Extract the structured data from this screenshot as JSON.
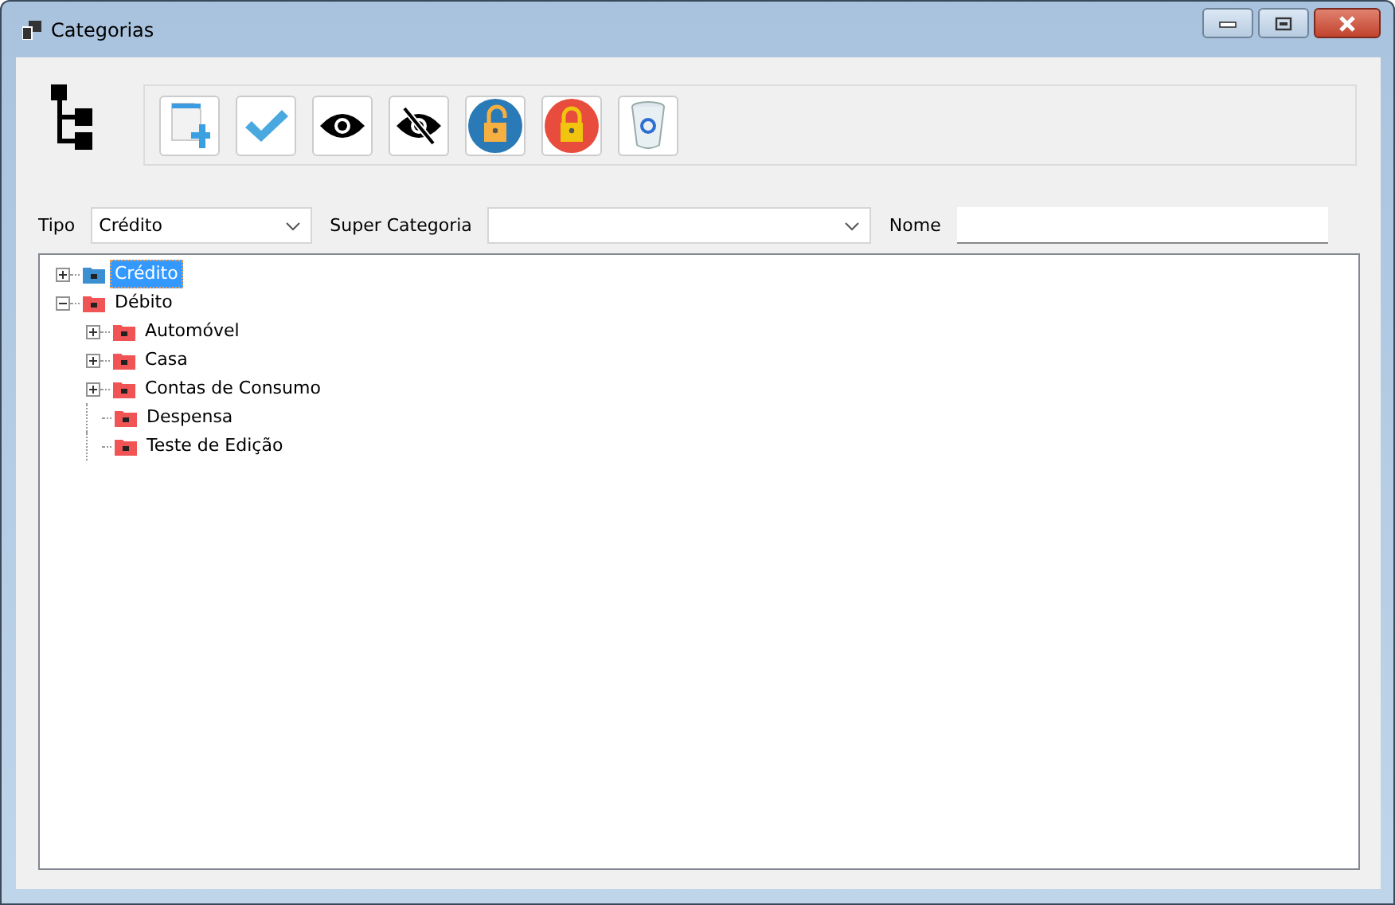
{
  "window": {
    "title": "Categorias"
  },
  "toolbar": {
    "buttons": [
      {
        "kind": "new"
      },
      {
        "kind": "confirm"
      },
      {
        "kind": "show"
      },
      {
        "kind": "hide"
      },
      {
        "kind": "unlock"
      },
      {
        "kind": "lock"
      },
      {
        "kind": "delete"
      }
    ]
  },
  "filters": {
    "tipo_label": "Tipo",
    "tipo_value": "Crédito",
    "super_label": "Super Categoria",
    "nome_label": "Nome"
  },
  "tree": [
    {
      "label": "Crédito",
      "color": "#3c8fd0",
      "expanded": false,
      "selected": true
    },
    {
      "label": "Débito",
      "color": "#f05454",
      "expanded": true,
      "selected": false,
      "children": [
        {
          "label": "Automóvel",
          "color": "#f05454",
          "expanded": false,
          "selected": false
        },
        {
          "label": "Casa",
          "color": "#f05454",
          "expanded": false,
          "selected": false
        },
        {
          "label": "Contas de Consumo",
          "color": "#f05454",
          "expanded": false,
          "selected": false
        },
        {
          "label": "Despensa",
          "color": "#f05454",
          "selected": false
        },
        {
          "label": "Teste de Edição",
          "color": "#f05454",
          "selected": false
        }
      ]
    }
  ]
}
